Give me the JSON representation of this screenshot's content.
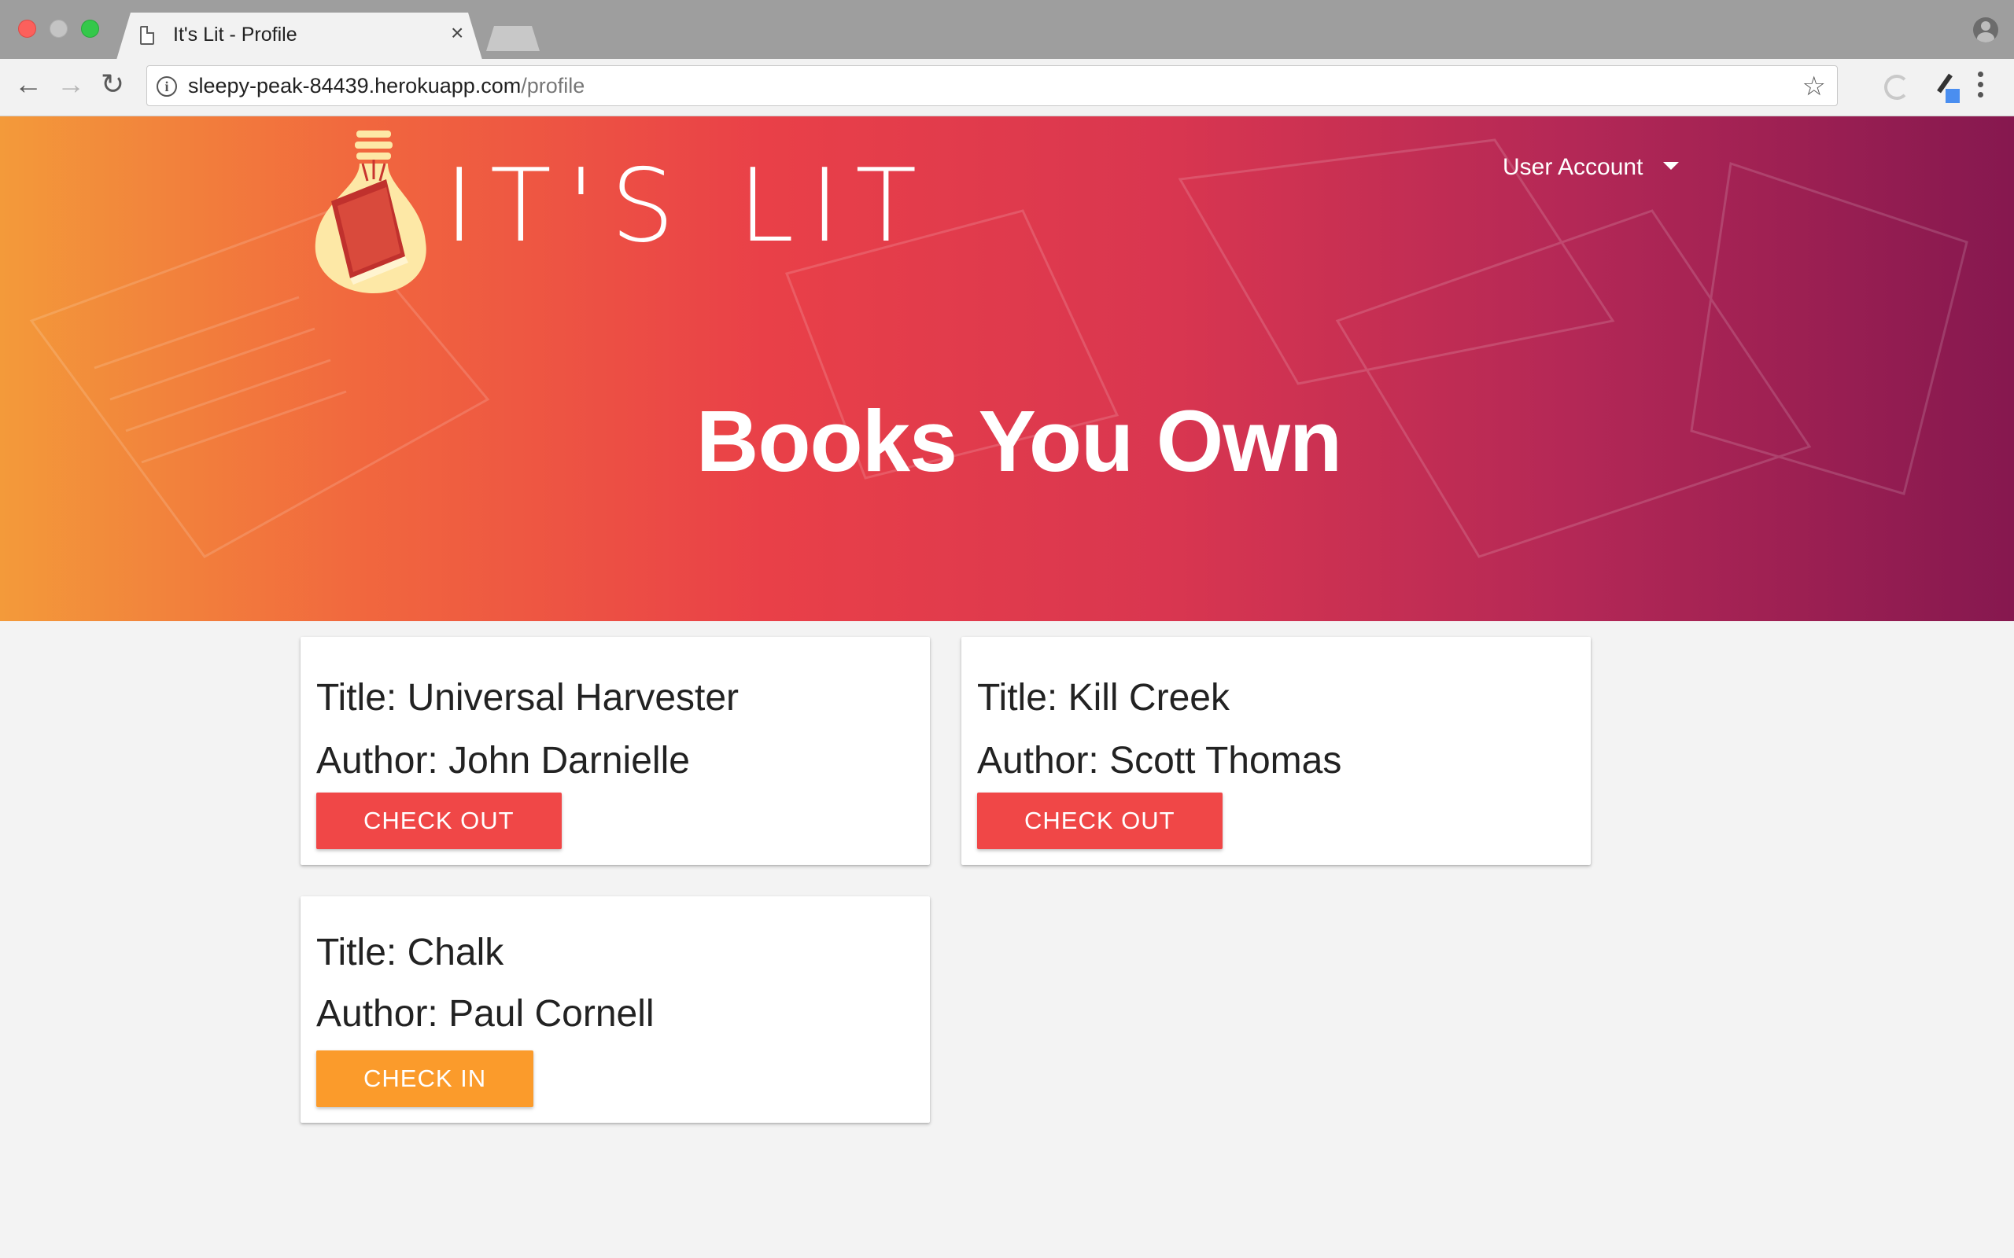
{
  "browser": {
    "tab_title": "It's Lit - Profile",
    "tab_close": "×",
    "url_host": "sleepy-peak-84439.herokuapp.com",
    "url_path": "/profile"
  },
  "nav": {
    "back": "←",
    "forward": "→",
    "reload": "↻",
    "star": "☆"
  },
  "site": {
    "logo_text": "IT'S LIT",
    "user_menu_label": "User Account",
    "page_heading": "Books You Own"
  },
  "books": [
    {
      "title": "Title: Universal Harvester",
      "author": "Author: John Darnielle",
      "action": "CHECK OUT",
      "action_color": "#f04747"
    },
    {
      "title": "Title: Kill Creek",
      "author": "Author: Scott Thomas",
      "action": "CHECK OUT",
      "action_color": "#f04747"
    },
    {
      "title": "Title: Chalk",
      "author": "Author: Paul Cornell",
      "action": "CHECK IN",
      "action_color": "#fb9b2b"
    }
  ],
  "colors": {
    "hero_gradient_start": "#f39a3a",
    "hero_gradient_mid": "#e94048",
    "hero_gradient_end": "#86184f",
    "check_out": "#f04747",
    "check_in": "#fb9b2b",
    "page_background": "#f3f3f3"
  }
}
